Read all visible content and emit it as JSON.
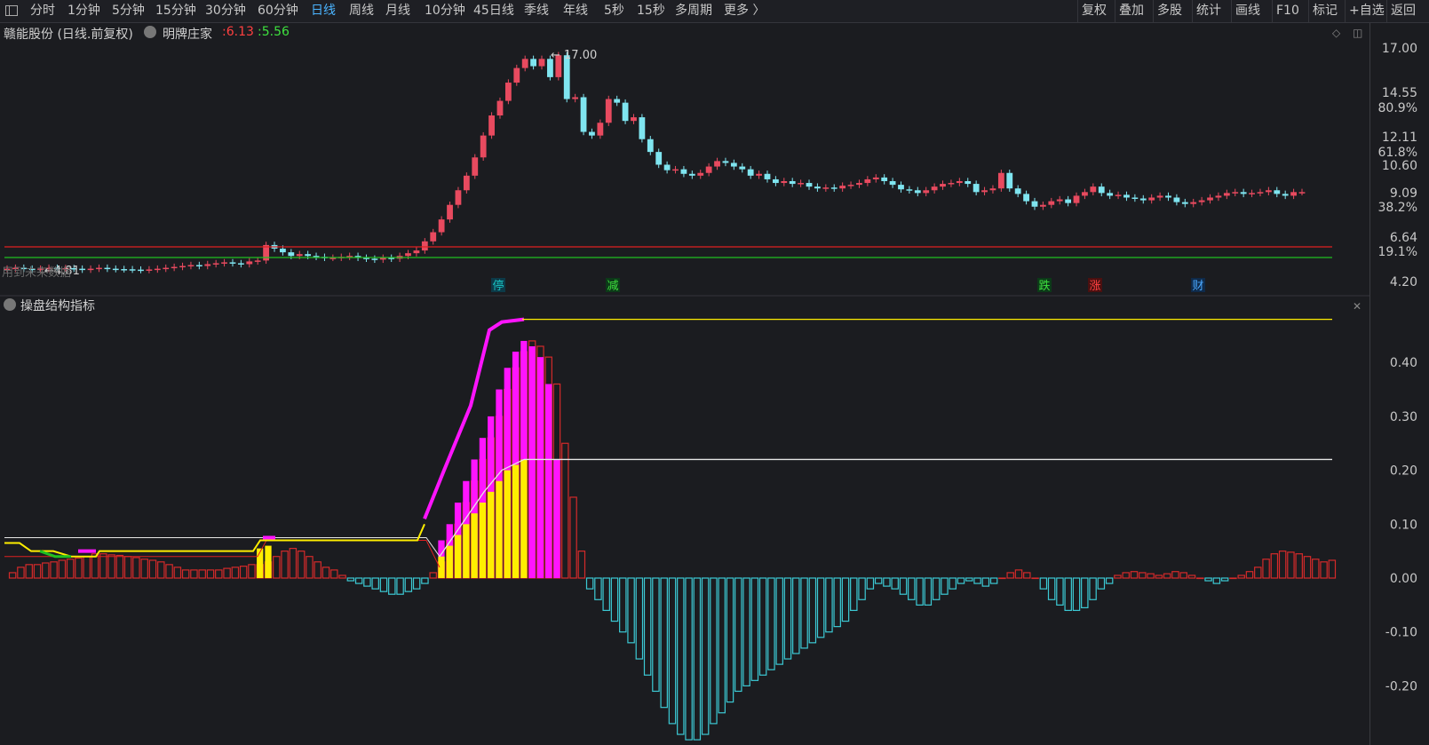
{
  "toolbar": {
    "left_items": [
      "分时",
      "1分钟",
      "5分钟",
      "15分钟",
      "30分钟",
      "60分钟",
      "日线",
      "周线",
      "月线",
      "10分钟",
      "45日线",
      "季线",
      "年线",
      "5秒",
      "15秒",
      "多周期",
      "更多 〉"
    ],
    "active": "日线",
    "right_items": [
      "复权",
      "叠加",
      "多股",
      "统计",
      "画线",
      "F10",
      "标记",
      "+自选",
      "返回"
    ]
  },
  "price_panel": {
    "title": "赣能股份 (日线.前复权)",
    "indicator_name": "明牌庄家",
    "indicator_value_red": "6.13",
    "indicator_value_green": "5.56",
    "high_label": "17.00",
    "low_label": "4.81",
    "note": "用到未来数据",
    "axis_prices": [
      "17.00",
      "14.55",
      "12.11",
      "10.60",
      "9.09",
      "6.64",
      "4.20"
    ],
    "axis_percents": [
      "80.9%",
      "61.8%",
      "38.2%",
      "19.1%"
    ],
    "markers": [
      {
        "text": "停",
        "color": "#19c3c3",
        "bg": "#0c3a48"
      },
      {
        "text": "减",
        "color": "#3ee03e",
        "bg": "#0c3a18"
      },
      {
        "text": "跌",
        "color": "#3ee03e",
        "bg": "#0c3a18"
      },
      {
        "text": "涨",
        "color": "#ff4040",
        "bg": "#4a1010"
      },
      {
        "text": "财",
        "color": "#4aa8ff",
        "bg": "#0f2a4a"
      }
    ]
  },
  "indicator_panel": {
    "title": "操盘结构指标",
    "axis": [
      "0.40",
      "0.30",
      "0.20",
      "0.10",
      "0.00",
      "-0.10",
      "-0.20"
    ]
  },
  "colors": {
    "background": "#1b1c20",
    "up": "#e84a5f",
    "down": "#7fe5f0",
    "positive_bar": "#d42a2a",
    "negative_bar": "#3cc9d4",
    "magenta": "#ff14ff",
    "yellow": "#ffee00",
    "white_line": "#e6e6e6",
    "red_line": "#e02020",
    "green_line": "#20c020"
  },
  "chart_data": {
    "type": "bar",
    "name": "操盘结构指标",
    "ylim": [
      -0.31,
      0.49
    ],
    "values": [
      0.01,
      0.02,
      0.025,
      0.025,
      0.028,
      0.03,
      0.033,
      0.035,
      0.037,
      0.04,
      0.045,
      0.045,
      0.043,
      0.042,
      0.04,
      0.038,
      0.035,
      0.033,
      0.03,
      0.025,
      0.02,
      0.015,
      0.015,
      0.015,
      0.015,
      0.015,
      0.018,
      0.02,
      0.022,
      0.025,
      0.025,
      0.03,
      0.04,
      0.05,
      0.055,
      0.05,
      0.04,
      0.03,
      0.02,
      0.015,
      0.005,
      -0.005,
      -0.01,
      -0.015,
      -0.02,
      -0.025,
      -0.03,
      -0.03,
      -0.025,
      -0.02,
      -0.01,
      0.01,
      0.03,
      0.07,
      0.1,
      0.14,
      0.18,
      0.22,
      0.26,
      0.3,
      0.35,
      0.39,
      0.42,
      0.44,
      0.43,
      0.41,
      0.36,
      0.25,
      0.15,
      0.05,
      -0.02,
      -0.04,
      -0.06,
      -0.08,
      -0.1,
      -0.12,
      -0.15,
      -0.18,
      -0.21,
      -0.24,
      -0.27,
      -0.29,
      -0.3,
      -0.3,
      -0.29,
      -0.27,
      -0.25,
      -0.23,
      -0.21,
      -0.2,
      -0.19,
      -0.18,
      -0.17,
      -0.16,
      -0.15,
      -0.14,
      -0.13,
      -0.12,
      -0.11,
      -0.1,
      -0.09,
      -0.08,
      -0.06,
      -0.04,
      -0.02,
      -0.01,
      -0.015,
      -0.02,
      -0.03,
      -0.04,
      -0.05,
      -0.05,
      -0.04,
      -0.03,
      -0.02,
      -0.01,
      -0.005,
      -0.01,
      -0.015,
      -0.01,
      0.0,
      0.01,
      0.015,
      0.01,
      0.0,
      -0.02,
      -0.04,
      -0.05,
      -0.06,
      -0.06,
      -0.055,
      -0.04,
      -0.02,
      -0.01,
      0.005,
      0.01,
      0.012,
      0.01,
      0.008,
      0.005,
      0.008,
      0.012,
      0.01,
      0.005,
      0.0,
      -0.005,
      -0.01,
      -0.005,
      0.0,
      0.005,
      0.012,
      0.02,
      0.035,
      0.045,
      0.05,
      0.048,
      0.045,
      0.04,
      0.035,
      0.03,
      0.033
    ],
    "yellow_values": [
      0,
      0,
      0,
      0,
      0,
      0,
      0,
      0,
      0,
      0,
      0,
      0,
      0,
      0,
      0,
      0,
      0,
      0,
      0,
      0,
      0,
      0,
      0,
      0,
      0,
      0,
      0,
      0,
      0,
      0,
      0.055,
      0.06,
      0,
      0,
      0,
      0,
      0,
      0,
      0,
      0,
      0,
      0,
      0,
      0,
      0,
      0,
      0,
      0,
      0,
      0,
      0,
      0,
      0.04,
      0.06,
      0.08,
      0.1,
      0.12,
      0.14,
      0.16,
      0.18,
      0.2,
      0.21,
      0.22
    ],
    "magenta_tops": [
      0,
      0,
      0,
      0,
      0,
      0,
      0,
      0,
      0,
      0,
      0,
      0,
      0,
      0,
      0,
      0,
      0,
      0,
      0,
      0,
      0,
      0,
      0,
      0,
      0,
      0,
      0,
      0,
      0,
      0,
      0,
      0,
      0,
      0,
      0,
      0,
      0,
      0,
      0,
      0,
      0,
      0,
      0,
      0,
      0,
      0,
      0,
      0,
      0,
      0,
      0,
      0,
      0.07,
      0.1,
      0.14,
      0.18,
      0.22,
      0.26,
      0.3,
      0.35,
      0.39,
      0.42,
      0.44,
      0.43,
      0.41,
      0.36,
      0.22
    ],
    "white_level_high": 0.22,
    "yellow_level_high": 0.48
  }
}
